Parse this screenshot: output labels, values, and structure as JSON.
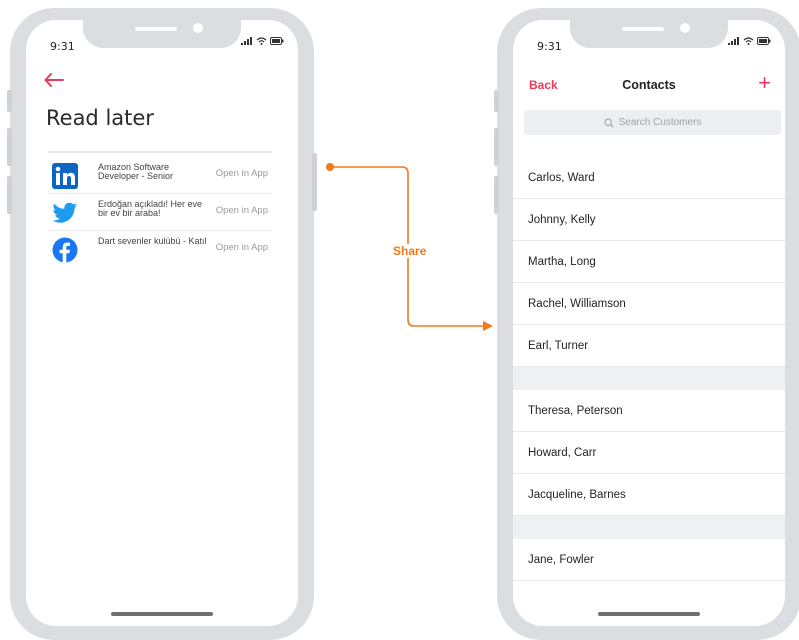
{
  "left_phone": {
    "status_time": "9:31",
    "back_icon": "arrow-left-icon",
    "title": "Read later",
    "items": [
      {
        "icon": "linkedin-icon",
        "text": "Amazon Software Developer - Senior",
        "action": "Open in App",
        "color": "#0a66c2"
      },
      {
        "icon": "twitter-icon",
        "text": "Erdoğan açıkladı! Her eve bir ev bir araba!",
        "action": "Open in App",
        "color": "#1d9bf0"
      },
      {
        "icon": "facebook-icon",
        "text": "Dart sevenler kulübü - Katıl",
        "action": "Open in App",
        "color": "#1877f2"
      }
    ]
  },
  "flow": {
    "label": "Share",
    "color": "#f27a1a"
  },
  "right_phone": {
    "status_time": "9:31",
    "nav": {
      "back": "Back",
      "title": "Contacts",
      "add": "+"
    },
    "search": {
      "placeholder": "Search Customers"
    },
    "groups": [
      [
        "Carlos, Ward",
        "Johnny, Kelly",
        "Martha, Long",
        "Rachel, Williamson",
        "Earl, Turner"
      ],
      [
        "Theresa, Peterson",
        "Howard, Carr",
        "Jacqueline, Barnes"
      ],
      [
        "Jane, Fowler"
      ]
    ]
  },
  "colors": {
    "accent": "#e83a5a",
    "frame": "#dcdde0"
  }
}
